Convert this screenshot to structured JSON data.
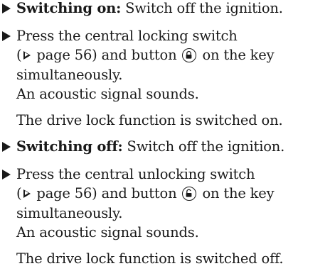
{
  "steps": [
    {
      "label": "Switching on:",
      "text": " Switch off the ignition."
    },
    {
      "line1": "Press the central locking switch",
      "page_ref_open": "(",
      "page_ref": " page 56) and button ",
      "page_ref_after": " on the key",
      "line3": "simultaneously.",
      "result1": "An acoustic signal sounds.",
      "result2": "The drive lock function is switched on.",
      "button_icon": "lock-icon"
    },
    {
      "label": "Switching off:",
      "text": " Switch off the ignition."
    },
    {
      "line1": "Press the central unlocking switch",
      "page_ref_open": "(",
      "page_ref": " page 56) and button ",
      "page_ref_after": " on the key",
      "line3": "simultaneously.",
      "result1": "An acoustic signal sounds.",
      "result2": "The drive lock function is switched off.",
      "button_icon": "unlock-icon"
    }
  ]
}
